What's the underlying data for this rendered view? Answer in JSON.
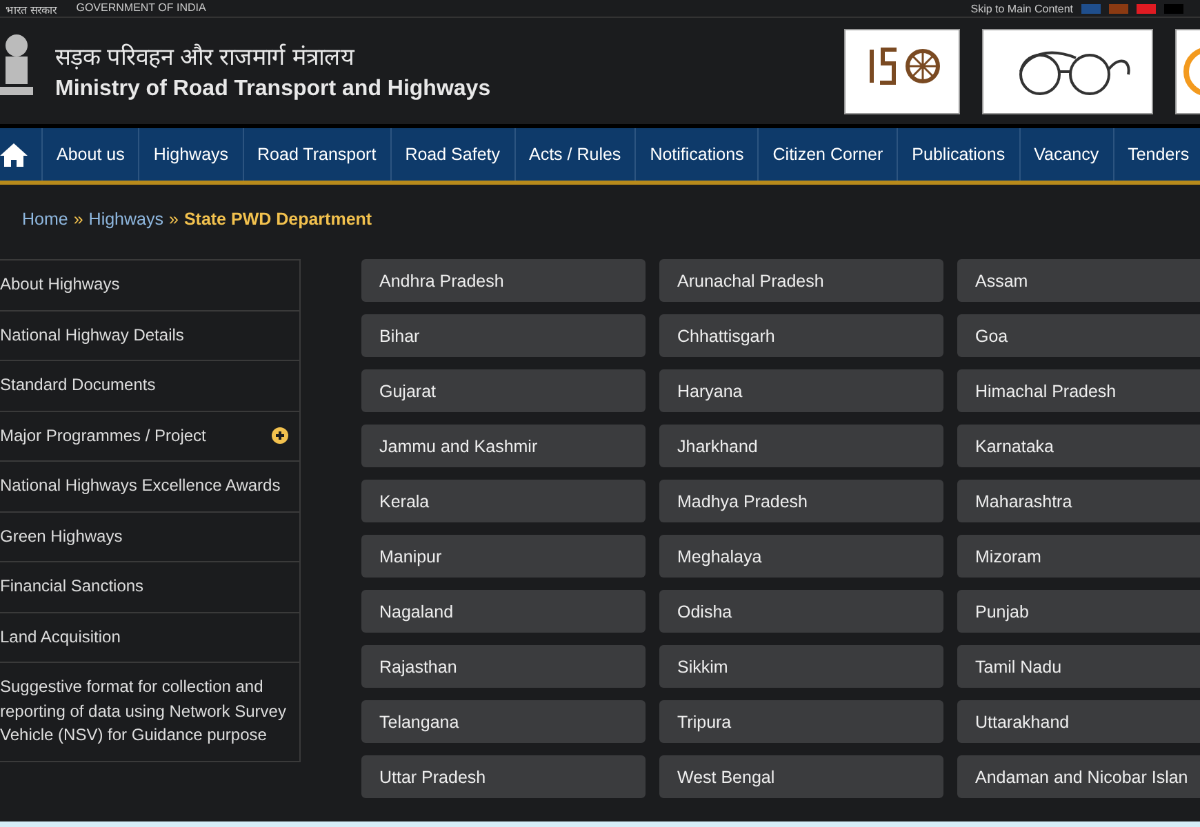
{
  "top_bar": {
    "left": [
      "भारत सरकार",
      "GOVERNMENT OF INDIA"
    ],
    "skip_link": "Skip to Main Content",
    "theme_swatches": [
      {
        "color": "#1f4e8c"
      },
      {
        "color": "#8b3a12"
      },
      {
        "color": "#e01b22"
      },
      {
        "color": "#000000"
      }
    ]
  },
  "header": {
    "title_hindi": "सड़क परिवहन और राजमार्ग मंत्रालय",
    "title": "Ministry of Road Transport and Highways"
  },
  "nav": [
    "About us",
    "Highways",
    "Road Transport",
    "Road Safety",
    "Acts / Rules",
    "Notifications",
    "Citizen Corner",
    "Publications",
    "Vacancy",
    "Tenders"
  ],
  "breadcrumb_separator": "»",
  "breadcrumb": [
    {
      "label": "Home",
      "current": false
    },
    {
      "label": "Highways",
      "current": false
    },
    {
      "label": "State PWD Department",
      "current": true
    }
  ],
  "sidebar": [
    {
      "label": "About Highways",
      "kind": "link"
    },
    {
      "label": "National Highway Details",
      "kind": "link"
    },
    {
      "label": "Standard Documents",
      "kind": "link"
    },
    {
      "label": "Major Programmes / Project",
      "kind": "expandable"
    },
    {
      "label": "National Highways Excellence Awards",
      "kind": "link"
    },
    {
      "label": "Green Highways",
      "kind": "link"
    },
    {
      "label": "Financial Sanctions",
      "kind": "link"
    },
    {
      "label": "Land Acquisition",
      "kind": "link"
    },
    {
      "label": "Suggestive format for collection and reporting of data using Network Survey Vehicle (NSV) for Guidance purpose",
      "kind": "link"
    }
  ],
  "states": [
    "Andhra Pradesh",
    "Arunachal Pradesh",
    "Assam",
    "Bihar",
    "Chhattisgarh",
    "Goa",
    "Gujarat",
    "Haryana",
    "Himachal Pradesh",
    "Jammu and Kashmir",
    "Jharkhand",
    "Karnataka",
    "Kerala",
    "Madhya Pradesh",
    "Maharashtra",
    "Manipur",
    "Meghalaya",
    "Mizoram",
    "Nagaland",
    "Odisha",
    "Punjab",
    "Rajasthan",
    "Sikkim",
    "Tamil Nadu",
    "Telangana",
    "Tripura",
    "Uttarakhand",
    "Uttar Pradesh",
    "West Bengal",
    "Andaman and Nicobar Islan"
  ]
}
